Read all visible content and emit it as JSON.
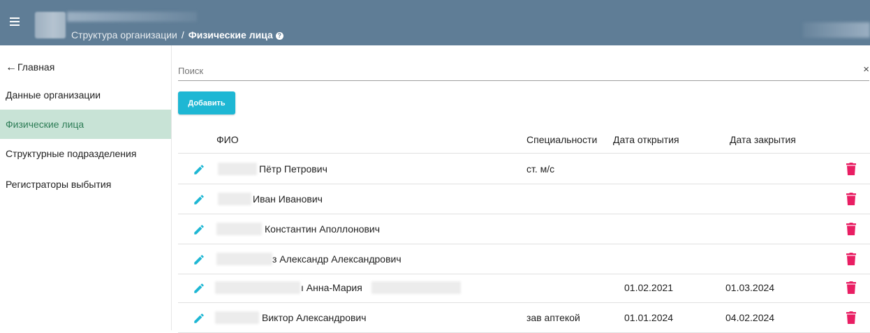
{
  "header": {
    "breadcrumb_parent": "Структура организации",
    "breadcrumb_separator": "/",
    "breadcrumb_current": "Физические лица",
    "help_glyph": "?"
  },
  "sidebar": {
    "back_label": "Главная",
    "items": [
      {
        "label": "Данные организации",
        "active": false
      },
      {
        "label": "Физические лица",
        "active": true
      },
      {
        "label": "Структурные подразделения",
        "active": false
      },
      {
        "label": "Регистраторы выбытия",
        "active": false
      }
    ]
  },
  "search": {
    "placeholder": "Поиск",
    "value": "",
    "clear_glyph": "×"
  },
  "add_button_label": "Добавить",
  "table": {
    "columns": [
      "ФИО",
      "Специальности",
      "Дата открытия",
      "Дата закрытия"
    ],
    "rows": [
      {
        "name": "Пётр Петрович",
        "specialty": "ст. м/с",
        "opened": "",
        "closed": ""
      },
      {
        "name": "Иван Иванович",
        "specialty": "",
        "opened": "",
        "closed": ""
      },
      {
        "name": "Константин Аполлонович",
        "specialty": "",
        "opened": "",
        "closed": ""
      },
      {
        "name": "з Александр Александрович",
        "specialty": "",
        "opened": "",
        "closed": ""
      },
      {
        "name": "ı Анна-Мария",
        "specialty": "",
        "opened": "01.02.2021",
        "closed": "01.03.2024"
      },
      {
        "name": "Виктор Александрович",
        "specialty": "зав аптекой",
        "opened": "01.01.2024",
        "closed": "04.02.2024"
      }
    ]
  },
  "colors": {
    "header_bg": "#5f7d96",
    "active_item_bg": "#c8e3d6",
    "active_item_text": "#2e7d57",
    "accent": "#1eb7d4",
    "delete": "#e91e63"
  },
  "icons": {
    "menu": "menu-icon",
    "back": "arrow-left-icon",
    "edit": "pencil-icon",
    "delete": "trash-icon",
    "clear": "close-icon",
    "help": "help-circle-icon"
  }
}
